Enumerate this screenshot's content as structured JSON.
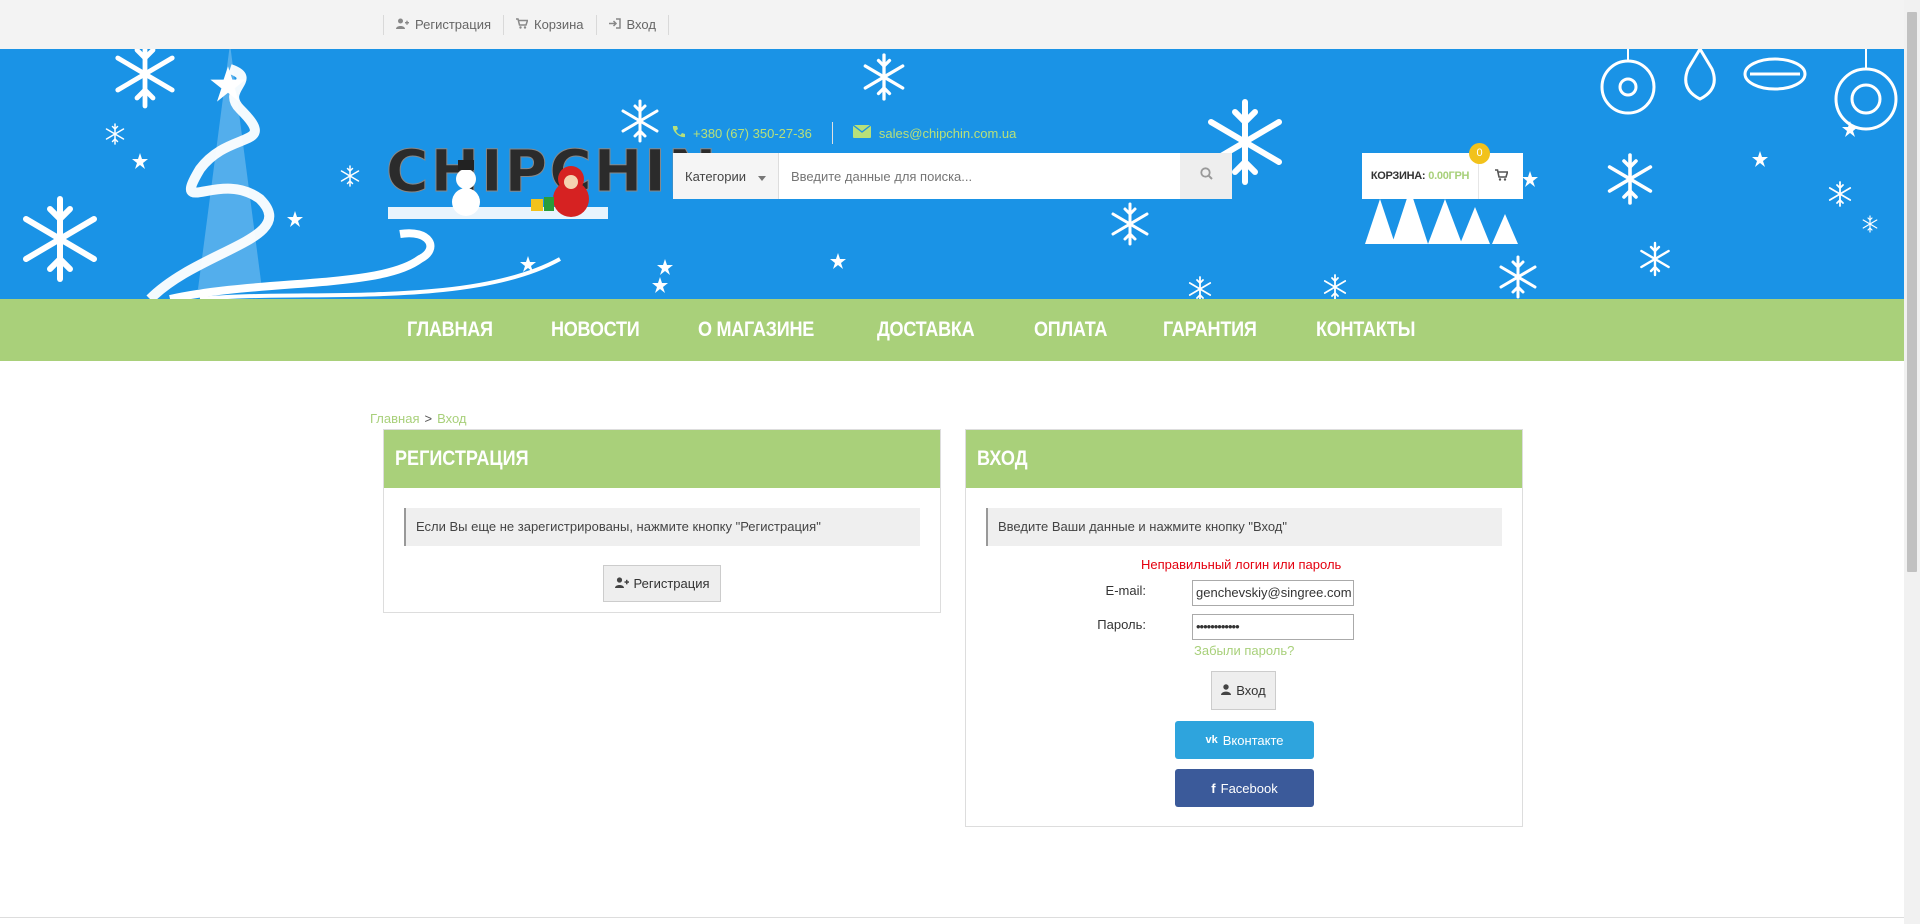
{
  "topbar": {
    "register_label": "Регистрация",
    "cart_label": "Корзина",
    "login_label": "Вход"
  },
  "header": {
    "logo_text": "CHIPCHIN",
    "phone": "+380 (67) 350-27-36",
    "email": "sales@chipchin.com.ua",
    "search": {
      "category_label": "Категории",
      "placeholder": "Введите данные для поиска..."
    },
    "cart": {
      "label": "КОРЗИНА:",
      "value": "0.00ГРН",
      "count": "0"
    }
  },
  "nav": {
    "items": [
      "ГЛАВНАЯ",
      "НОВОСТИ",
      "О МАГАЗИНЕ",
      "ДОСТАВКА",
      "ОПЛАТА",
      "ГАРАНТИЯ",
      "КОНТАКТЫ"
    ]
  },
  "breadcrumb": {
    "home": "Главная",
    "sep": ">",
    "current": "Вход"
  },
  "register_panel": {
    "title": "РЕГИСТРАЦИЯ",
    "note": "Если Вы еще не зарегистрированы, нажмите кнопку \"Регистрация\"",
    "button": "Регистрация"
  },
  "login_panel": {
    "title": "ВХОД",
    "note": "Введите Ваши данные и нажмите кнопку \"Вход\"",
    "error": "Неправильный логин или пароль",
    "email_label": "E-mail:",
    "email_value": "genchevskiy@singree.com",
    "password_label": "Пароль:",
    "password_value": "••••••••••••",
    "forgot": "Забыли пароль?",
    "login_button": "Вход",
    "vk_button": "Вконтакте",
    "fb_button": "Facebook"
  },
  "colors": {
    "accent_green": "#a9d07a",
    "header_blue": "#1a93e6",
    "error_red": "#e4000f",
    "vk_blue": "#2ea4dd",
    "fb_blue": "#3b5a9a"
  }
}
